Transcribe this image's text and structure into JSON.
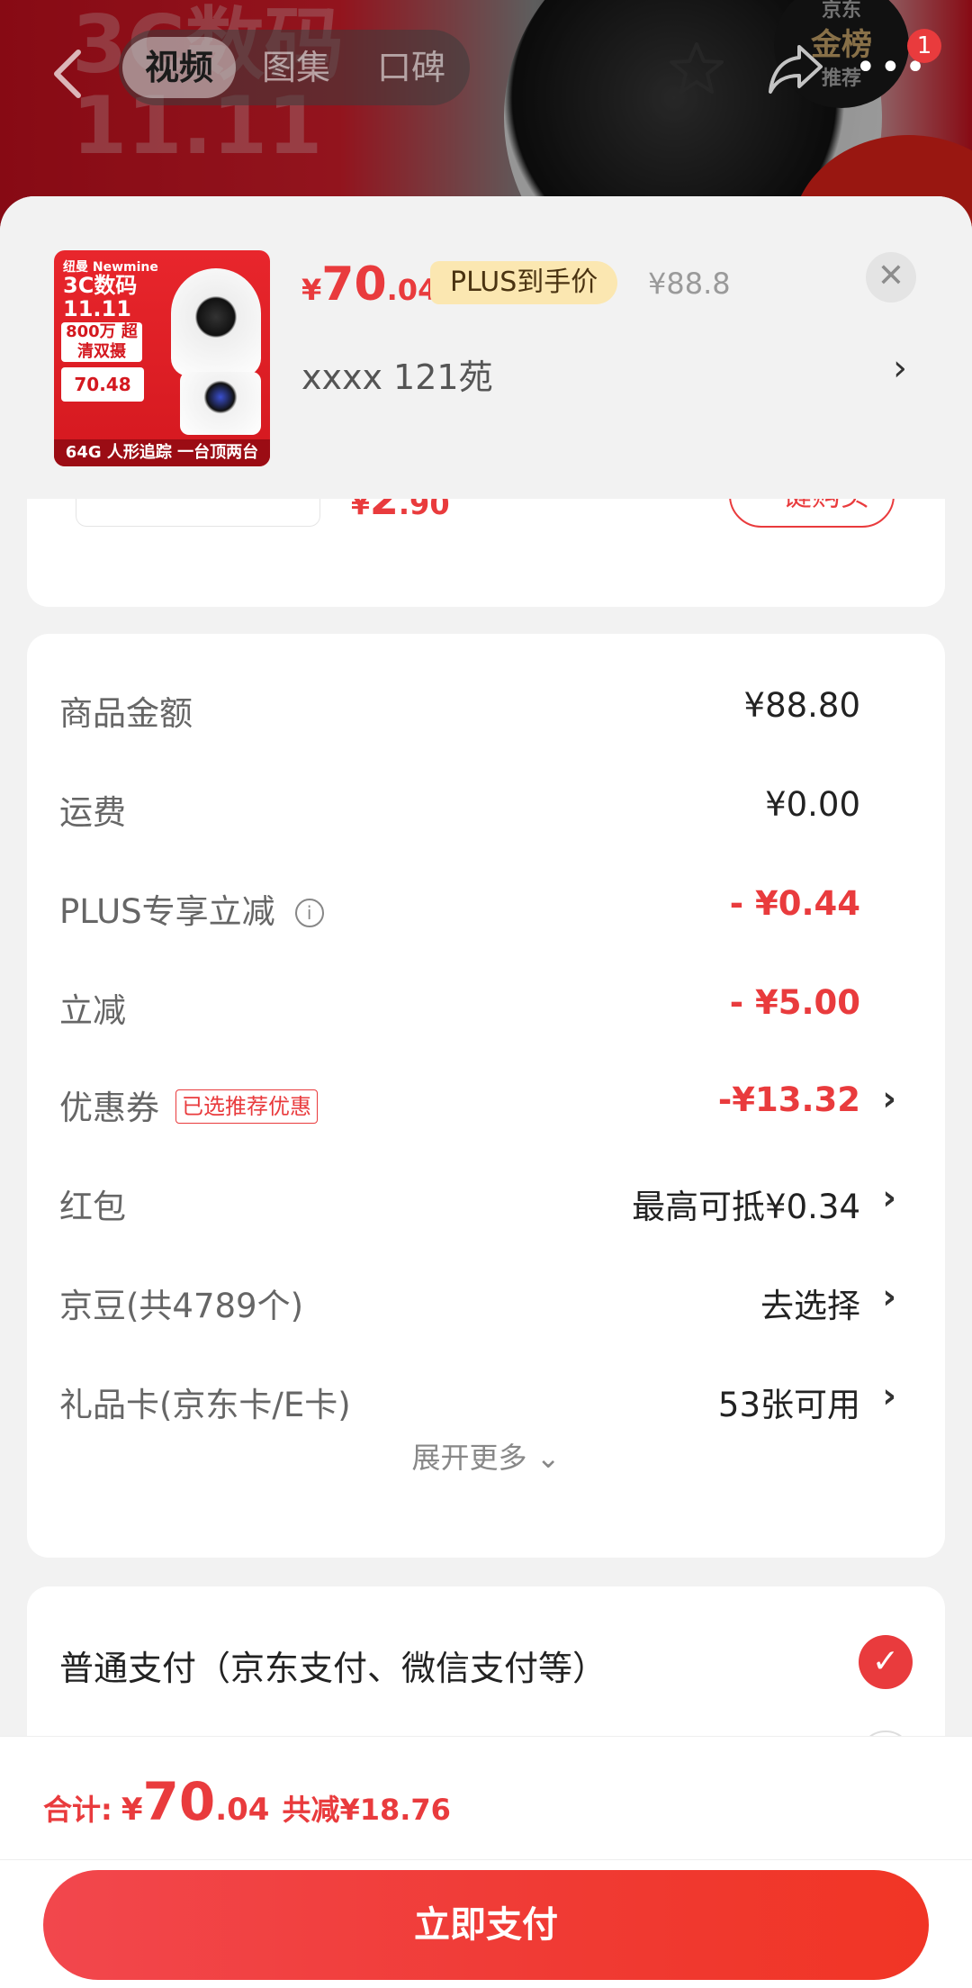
{
  "product_page": {
    "hero_text_1": "3C数码",
    "hero_text_2": "11.11",
    "tabs": [
      {
        "label": "视频",
        "active": true
      },
      {
        "label": "图集",
        "active": false
      },
      {
        "label": "口碑",
        "active": false
      }
    ],
    "badge_line1": "京东",
    "badge_line2": "金榜",
    "badge_line3": "推荐",
    "notification_count": "1"
  },
  "order_sheet": {
    "thumbnail": {
      "brand": "纽曼 Newmine",
      "title_line1": "3C数码",
      "title_line2": "11.11",
      "spec": "800万 超清双摄",
      "price_tag": "70.48",
      "footer": "人形追踪 一台顶两台",
      "storage": "64G"
    },
    "price": {
      "currency": "¥",
      "integer": "70",
      "decimal": ".04"
    },
    "plus_tag": "PLUS到手价",
    "original_price": "¥88.8",
    "address": "xxxx  121苑",
    "upsell": {
      "price": {
        "currency": "¥",
        "integer": "2",
        "decimal": ".90"
      },
      "button_label": "一键购买"
    },
    "summary": [
      {
        "label": "商品金额",
        "value": "¥88.80",
        "red": false
      },
      {
        "label": "运费",
        "value": "¥0.00",
        "red": false
      },
      {
        "label": "PLUS专享立减",
        "value": "- ¥0.44",
        "red": true
      },
      {
        "label": "立减",
        "value": "- ¥5.00",
        "red": true
      },
      {
        "label": "优惠券",
        "tag": "已选推荐优惠",
        "value": "-¥13.32",
        "red": true
      },
      {
        "label": "红包",
        "value": "最高可抵¥0.34",
        "red": false
      },
      {
        "label": "京豆(共4789个)",
        "value": "去选择",
        "red": false
      },
      {
        "label": "礼品卡(京东卡/E卡)",
        "value": "53张可用",
        "red": false
      }
    ],
    "expand_label": "展开更多",
    "payment_method": "普通支付（京东支付、微信支付等）"
  },
  "bottom_bar": {
    "total_label": "合计:",
    "total": {
      "currency": "¥",
      "integer": "70",
      "decimal": ".04"
    },
    "saved": "共减¥18.76",
    "pay_button": "立即支付"
  },
  "colors": {
    "accent_red": "#e93b3d",
    "plus_gold": "#fbe7b1",
    "background": "#f2f2f2"
  },
  "icons": [
    "back-icon",
    "star-icon",
    "share-icon",
    "more-icon",
    "close-icon",
    "chevron-right-icon",
    "info-icon",
    "check-icon",
    "chevron-down-icon"
  ]
}
